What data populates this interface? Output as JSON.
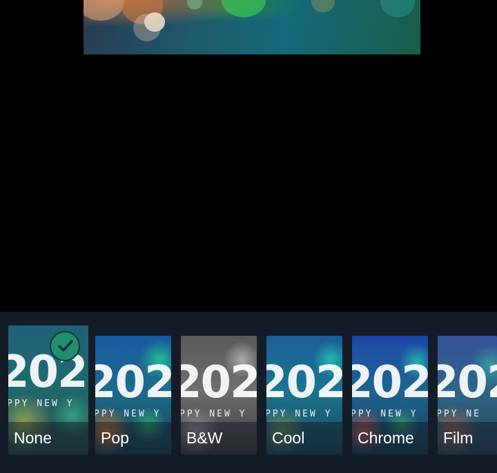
{
  "preview": {
    "image_name": "bokeh-preview"
  },
  "filters": {
    "selected": "None",
    "items": [
      {
        "label": "None",
        "year": "202",
        "greeting": "PPY NEW Y"
      },
      {
        "label": "Pop",
        "year": "202",
        "greeting": "PPY NEW Y"
      },
      {
        "label": "B&W",
        "year": "202",
        "greeting": "PPY NEW Y"
      },
      {
        "label": "Cool",
        "year": "202",
        "greeting": "PPY NEW Y"
      },
      {
        "label": "Chrome",
        "year": "202",
        "greeting": "PPY NEW Y"
      },
      {
        "label": "Film",
        "year": "202",
        "greeting": "PPY NE"
      }
    ]
  },
  "colors": {
    "strip_background": "#141d27",
    "check_badge": "#1f8f6e"
  },
  "icons": {
    "selected_indicator": "check-icon"
  }
}
